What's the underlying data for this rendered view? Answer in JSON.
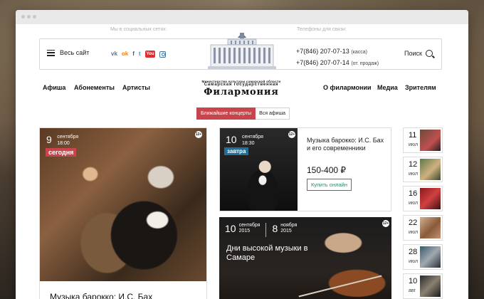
{
  "social_caption": "Мы в социальных сетях:",
  "phones_caption": "Телефоны для связи:",
  "menu_label": "Весь сайт",
  "socials": [
    {
      "name": "vk-icon",
      "glyph": "vk"
    },
    {
      "name": "odnoklassniki-icon",
      "glyph": "ok"
    },
    {
      "name": "facebook-icon",
      "glyph": "f"
    },
    {
      "name": "twitter-icon",
      "glyph": "t"
    },
    {
      "name": "youtube-icon",
      "glyph": "You"
    },
    {
      "name": "instagram-icon",
      "glyph": ""
    }
  ],
  "phones": [
    {
      "number": "+7(846) 207-07-13",
      "note": "(касса)"
    },
    {
      "number": "+7(846) 207-07-14",
      "note": "(от. продаж)"
    }
  ],
  "search_label": "Поиск",
  "nav": {
    "left": [
      "Афиша",
      "Абонементы",
      "Артисты"
    ],
    "right": [
      "О филармонии",
      "Медиа",
      "Зрителям"
    ]
  },
  "logo": {
    "small": "Министерство культуры самарской области",
    "mid": "Самарская государственная",
    "big": "Филармония"
  },
  "tabs": {
    "active": "Ближайшие концерты",
    "other": "Вся афиша"
  },
  "featured": {
    "day": "9",
    "month": "сентября",
    "time": "18:00",
    "badge": "сегодня",
    "age": "12+",
    "title": "Музыка барокко: И.С. Бах"
  },
  "event2": {
    "day": "10",
    "month": "сентября",
    "time": "18:30",
    "badge": "завтра",
    "age": "12+",
    "title": "Музыка барокко: И.С. Бах и его современники",
    "price": "150-400 ₽",
    "button": "Купить онлайн"
  },
  "event3": {
    "start_day": "10",
    "start_month": "сентября",
    "start_year": "2015",
    "end_day": "8",
    "end_month": "ноября",
    "end_year": "2015",
    "age": "12+",
    "title": "Дни высокой музыки в Самаре"
  },
  "sidebar": [
    {
      "day": "11",
      "month": "июл"
    },
    {
      "day": "12",
      "month": "июл"
    },
    {
      "day": "16",
      "month": "июл"
    },
    {
      "day": "22",
      "month": "июл"
    },
    {
      "day": "28",
      "month": "июл"
    },
    {
      "day": "10",
      "month": "авг"
    }
  ],
  "colors": {
    "accent_red": "#c8464b",
    "accent_blue": "#1f6f9a",
    "accent_green": "#2b8a6e"
  }
}
